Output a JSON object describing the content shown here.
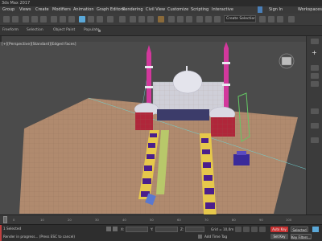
{
  "window": {
    "title": "3ds Max 2017"
  },
  "menubar": {
    "items": [
      {
        "label": "Group"
      },
      {
        "label": "Views"
      },
      {
        "label": "Create"
      },
      {
        "label": "Modifiers"
      },
      {
        "label": "Animation"
      },
      {
        "label": "Graph Editors"
      },
      {
        "label": "Rendering"
      },
      {
        "label": "Civil View"
      },
      {
        "label": "Customize"
      },
      {
        "label": "Scripting"
      },
      {
        "label": "Interactive"
      }
    ],
    "sign_in_label": "Sign In",
    "workspaces_label": "Workspaces"
  },
  "toolbar": {
    "selection_set_value": "Create Selection Se"
  },
  "ribbon": {
    "tabs": [
      {
        "label": "Freeform"
      },
      {
        "label": "Selection"
      },
      {
        "label": "Object Paint"
      },
      {
        "label": "Populate"
      }
    ]
  },
  "viewport": {
    "label": "[+][Perspective][Standard][Edged Faces]",
    "colors": {
      "background": "#4b4b4b",
      "ground": "#b08a6e",
      "minaret": "#d2389c",
      "dome": "#dcdcdc",
      "stripe_purple": "#4b1f8c",
      "stripe_yellow": "#e6c84b"
    }
  },
  "command_panel": {
    "plus_icon": "+"
  },
  "timeline": {
    "ticks": [
      "0",
      "10",
      "20",
      "30",
      "40",
      "50",
      "60",
      "70",
      "80",
      "90",
      "100"
    ],
    "current_frame": "0 / 100"
  },
  "statusbar": {
    "selected_label": "1 Selected",
    "prompt": "Render in progress... (Press ESC to cancel)",
    "x_label": "X:",
    "x_value": "",
    "y_label": "Y:",
    "y_value": "",
    "z_label": "Z:",
    "grid_label": "Grid = 10,0m",
    "add_time_tag_label": "Add Time Tag",
    "auto_key_label": "Auto Key",
    "set_key_label": "Set Key",
    "selected_dropdown_value": "Selected",
    "key_filters_label": "Key Filters..."
  }
}
